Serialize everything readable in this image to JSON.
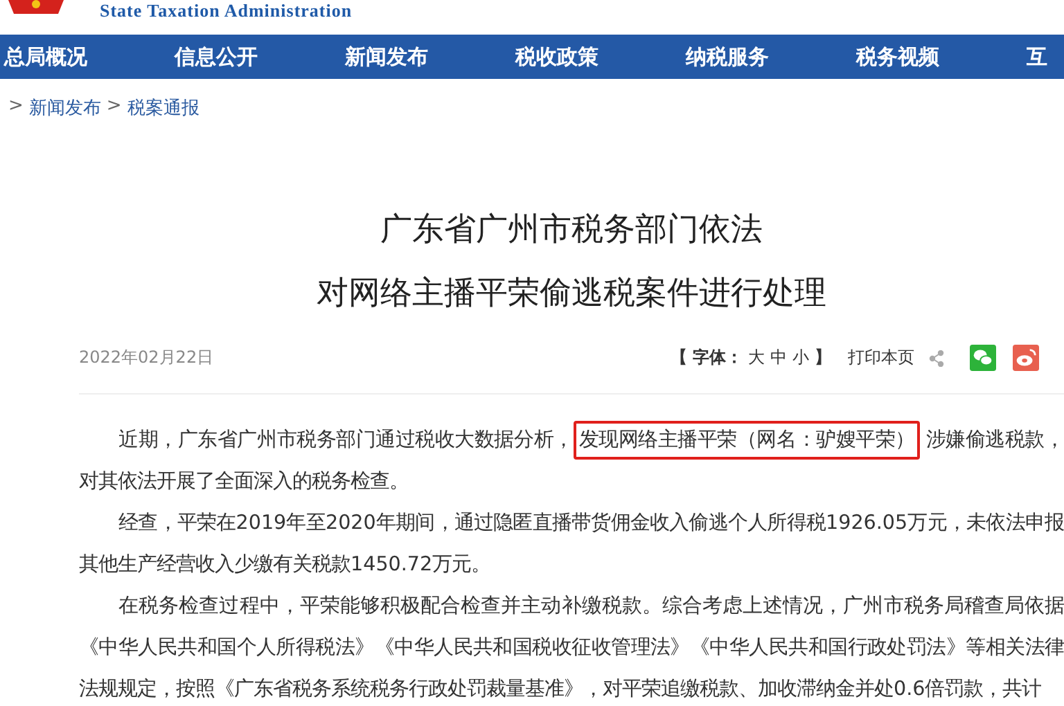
{
  "header": {
    "english_name": "State Taxation Administration"
  },
  "nav": [
    {
      "label": "总局概况"
    },
    {
      "label": "信息公开"
    },
    {
      "label": "新闻发布"
    },
    {
      "label": "税收政策"
    },
    {
      "label": "纳税服务"
    },
    {
      "label": "税务视频"
    },
    {
      "label": "互"
    }
  ],
  "breadcrumb": [
    {
      "separator": ">",
      "label": "新闻发布"
    },
    {
      "separator": ">",
      "label": "税案通报"
    }
  ],
  "article": {
    "title_lines": [
      "广东省广州市税务部门依法",
      "对网络主播平荣偷逃税案件进行处理"
    ],
    "date": "2022年02月22日",
    "font_size": {
      "open": "【",
      "label": "字体：",
      "sizes": [
        "大",
        "中",
        "小"
      ],
      "close": "】"
    },
    "print": "打印本页",
    "paragraphs": [
      {
        "segments": [
          {
            "text": "近期，广东省广州市税务部门通过税收大数据分析，",
            "highlighted": false
          },
          {
            "text": "发现网络主播平荣（网名：驴嫂平荣）",
            "highlighted": true
          },
          {
            "text": "涉嫌偷逃税款，对其依法开展了全面深入的税务检查。",
            "highlighted": false
          }
        ]
      },
      {
        "segments": [
          {
            "text": "经查，平荣在2019年至2020年期间，通过隐匿直播带货佣金收入偷逃个人所得税1926.05万元，未依法申报其他生产经营收入少缴有关税款1450.72万元。",
            "highlighted": false
          }
        ]
      },
      {
        "segments": [
          {
            "text": "在税务检查过程中，平荣能够积极配合检查并主动补缴税款。综合考虑上述情况，广州市税务局稽查局依据《中华人民共和国个人所得税法》《中华人民共和国税收征收管理法》《中华人民共和国行政处罚法》等相关法律法规规定，按照《广东省税务系统税务行政处罚裁量基准》，对平荣追缴税款、加收滞纳金并处0.6倍罚款，共计",
            "highlighted": false
          }
        ]
      }
    ]
  }
}
